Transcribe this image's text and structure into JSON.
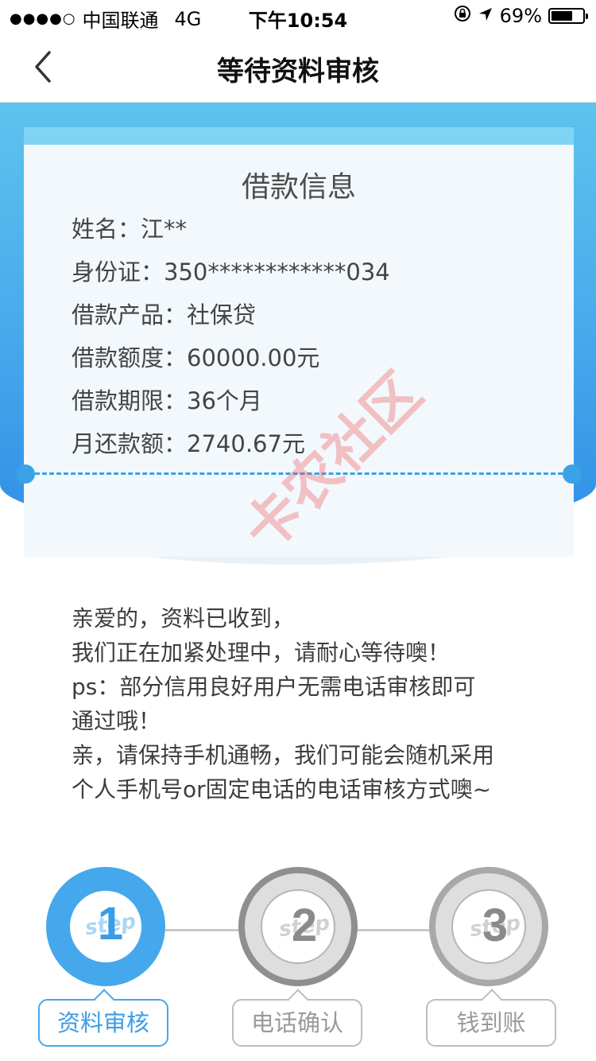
{
  "status_bar": {
    "signal": "●●●●○",
    "carrier": "中国联通",
    "network": "4G",
    "time": "下午10:54",
    "battery_percent": "69%",
    "battery_level": 0.69,
    "icons": [
      "lock-rotation-icon",
      "location-arrow-icon",
      "battery-icon"
    ]
  },
  "nav": {
    "title": "等待资料审核",
    "back_icon": "chevron-left-icon"
  },
  "ticket": {
    "title": "借款信息",
    "rows": [
      {
        "label": "姓名：",
        "value": "江**"
      },
      {
        "label": "身份证：",
        "value": "350************034"
      },
      {
        "label": "借款产品：",
        "value": "社保贷"
      },
      {
        "label": "借款额度：",
        "value": "60000.00元"
      },
      {
        "label": "借款期限：",
        "value": "36个月"
      },
      {
        "label": "月还款额：",
        "value": "2740.67元"
      }
    ]
  },
  "watermark": "卡农社区",
  "message": [
    "亲爱的，资料已收到，",
    "我们正在加紧处理中，请耐心等待噢！",
    "ps：部分信用良好用户无需电话审核即可",
    "通过哦！",
    "亲，请保持手机通畅，我们可能会随机采用",
    "个人手机号or固定电话的电话审核方式噢~"
  ],
  "steps": {
    "step_word": "step",
    "items": [
      {
        "number": "1",
        "label": "资料审核",
        "active": true
      },
      {
        "number": "2",
        "label": "电话确认",
        "active": false
      },
      {
        "number": "3",
        "label": "钱到账",
        "active": false
      }
    ]
  },
  "colors": {
    "accent": "#3aa2e6",
    "inactive": "#9a9a9a",
    "header_gradient_top": "#5ec3ef",
    "header_gradient_bottom": "#2f8fe6"
  }
}
